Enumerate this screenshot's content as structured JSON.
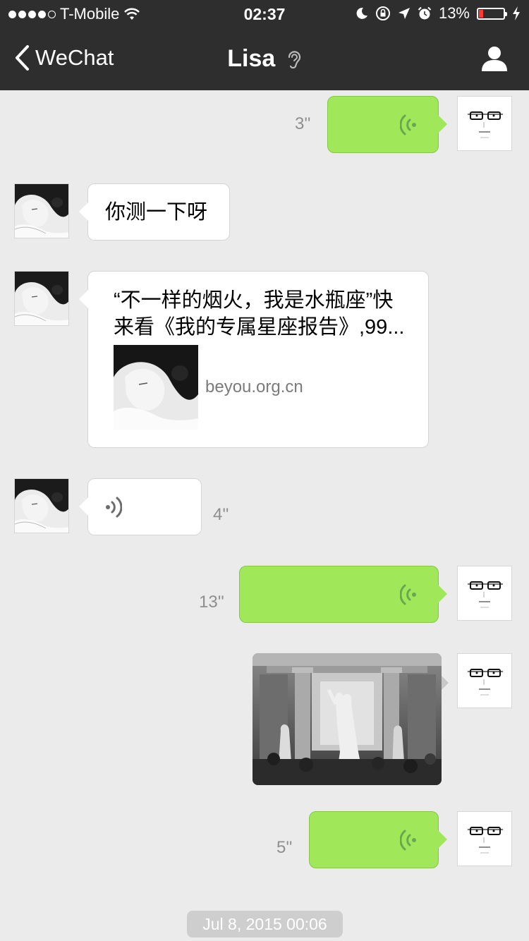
{
  "status_bar": {
    "carrier": "T-Mobile",
    "time": "02:37",
    "battery_percent": "13%",
    "signal_bars_filled": 4,
    "signal_bars_total": 5
  },
  "nav": {
    "back_label": "WeChat",
    "title": "Lisa",
    "icons": [
      "chevron-left-icon",
      "ear-icon",
      "profile-icon"
    ]
  },
  "messages": [
    {
      "sender": "self",
      "type": "voice",
      "duration": "3''"
    },
    {
      "sender": "Lisa",
      "type": "text",
      "text": "你测一下呀"
    },
    {
      "sender": "Lisa",
      "type": "link",
      "title_line1": "“不一样的烟火，我是水瓶座”快",
      "title_line2": "来看《我的专属星座报告》,99...",
      "domain": "beyou.org.cn"
    },
    {
      "sender": "Lisa",
      "type": "voice",
      "duration": "4''"
    },
    {
      "sender": "self",
      "type": "voice",
      "duration": "13''"
    },
    {
      "sender": "self",
      "type": "image"
    },
    {
      "sender": "self",
      "type": "voice",
      "duration": "5''"
    }
  ],
  "timestamp": "Jul 8, 2015 00:06",
  "colors": {
    "navbar": "#2e2e2f",
    "background": "#ebebeb",
    "self_bubble": "#a0e75a",
    "other_bubble": "#ffffff",
    "battery_low": "#ff3b30"
  }
}
